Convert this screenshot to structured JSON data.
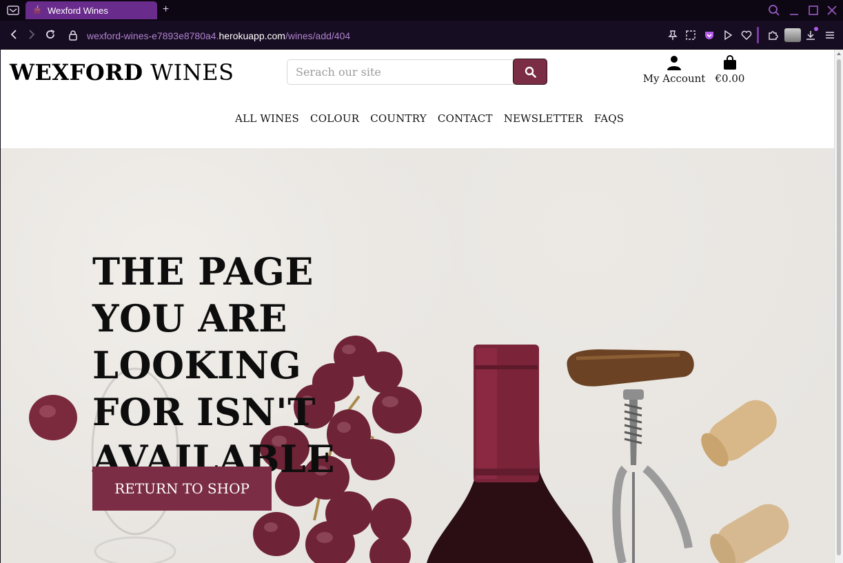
{
  "browser": {
    "tab_title": "Wexford Wines",
    "new_tab_label": "+",
    "url_prefix": "wexford-wines-e7893e8780a4.",
    "url_host": "herokuapp.com",
    "url_path": "/wines/add/404",
    "accent_color": "#6a2c8c"
  },
  "site": {
    "brand_bold": "WEXFORD",
    "brand_rest": " WINES",
    "search_placeholder": "Serach our site",
    "account_label": "My Account",
    "bag_total": "€0.00",
    "brand_color": "#7b2d45"
  },
  "nav": {
    "items": [
      "ALL WINES",
      "COLOUR",
      "COUNTRY",
      "CONTACT",
      "NEWSLETTER",
      "FAQS"
    ]
  },
  "hero": {
    "headline": "THE PAGE YOU ARE LOOKING FOR ISN'T AVAILABLE",
    "cta_label": "RETURN TO SHOP"
  },
  "icons": {
    "search": "search-icon",
    "user": "user-icon",
    "bag": "shopping-bag-icon"
  }
}
